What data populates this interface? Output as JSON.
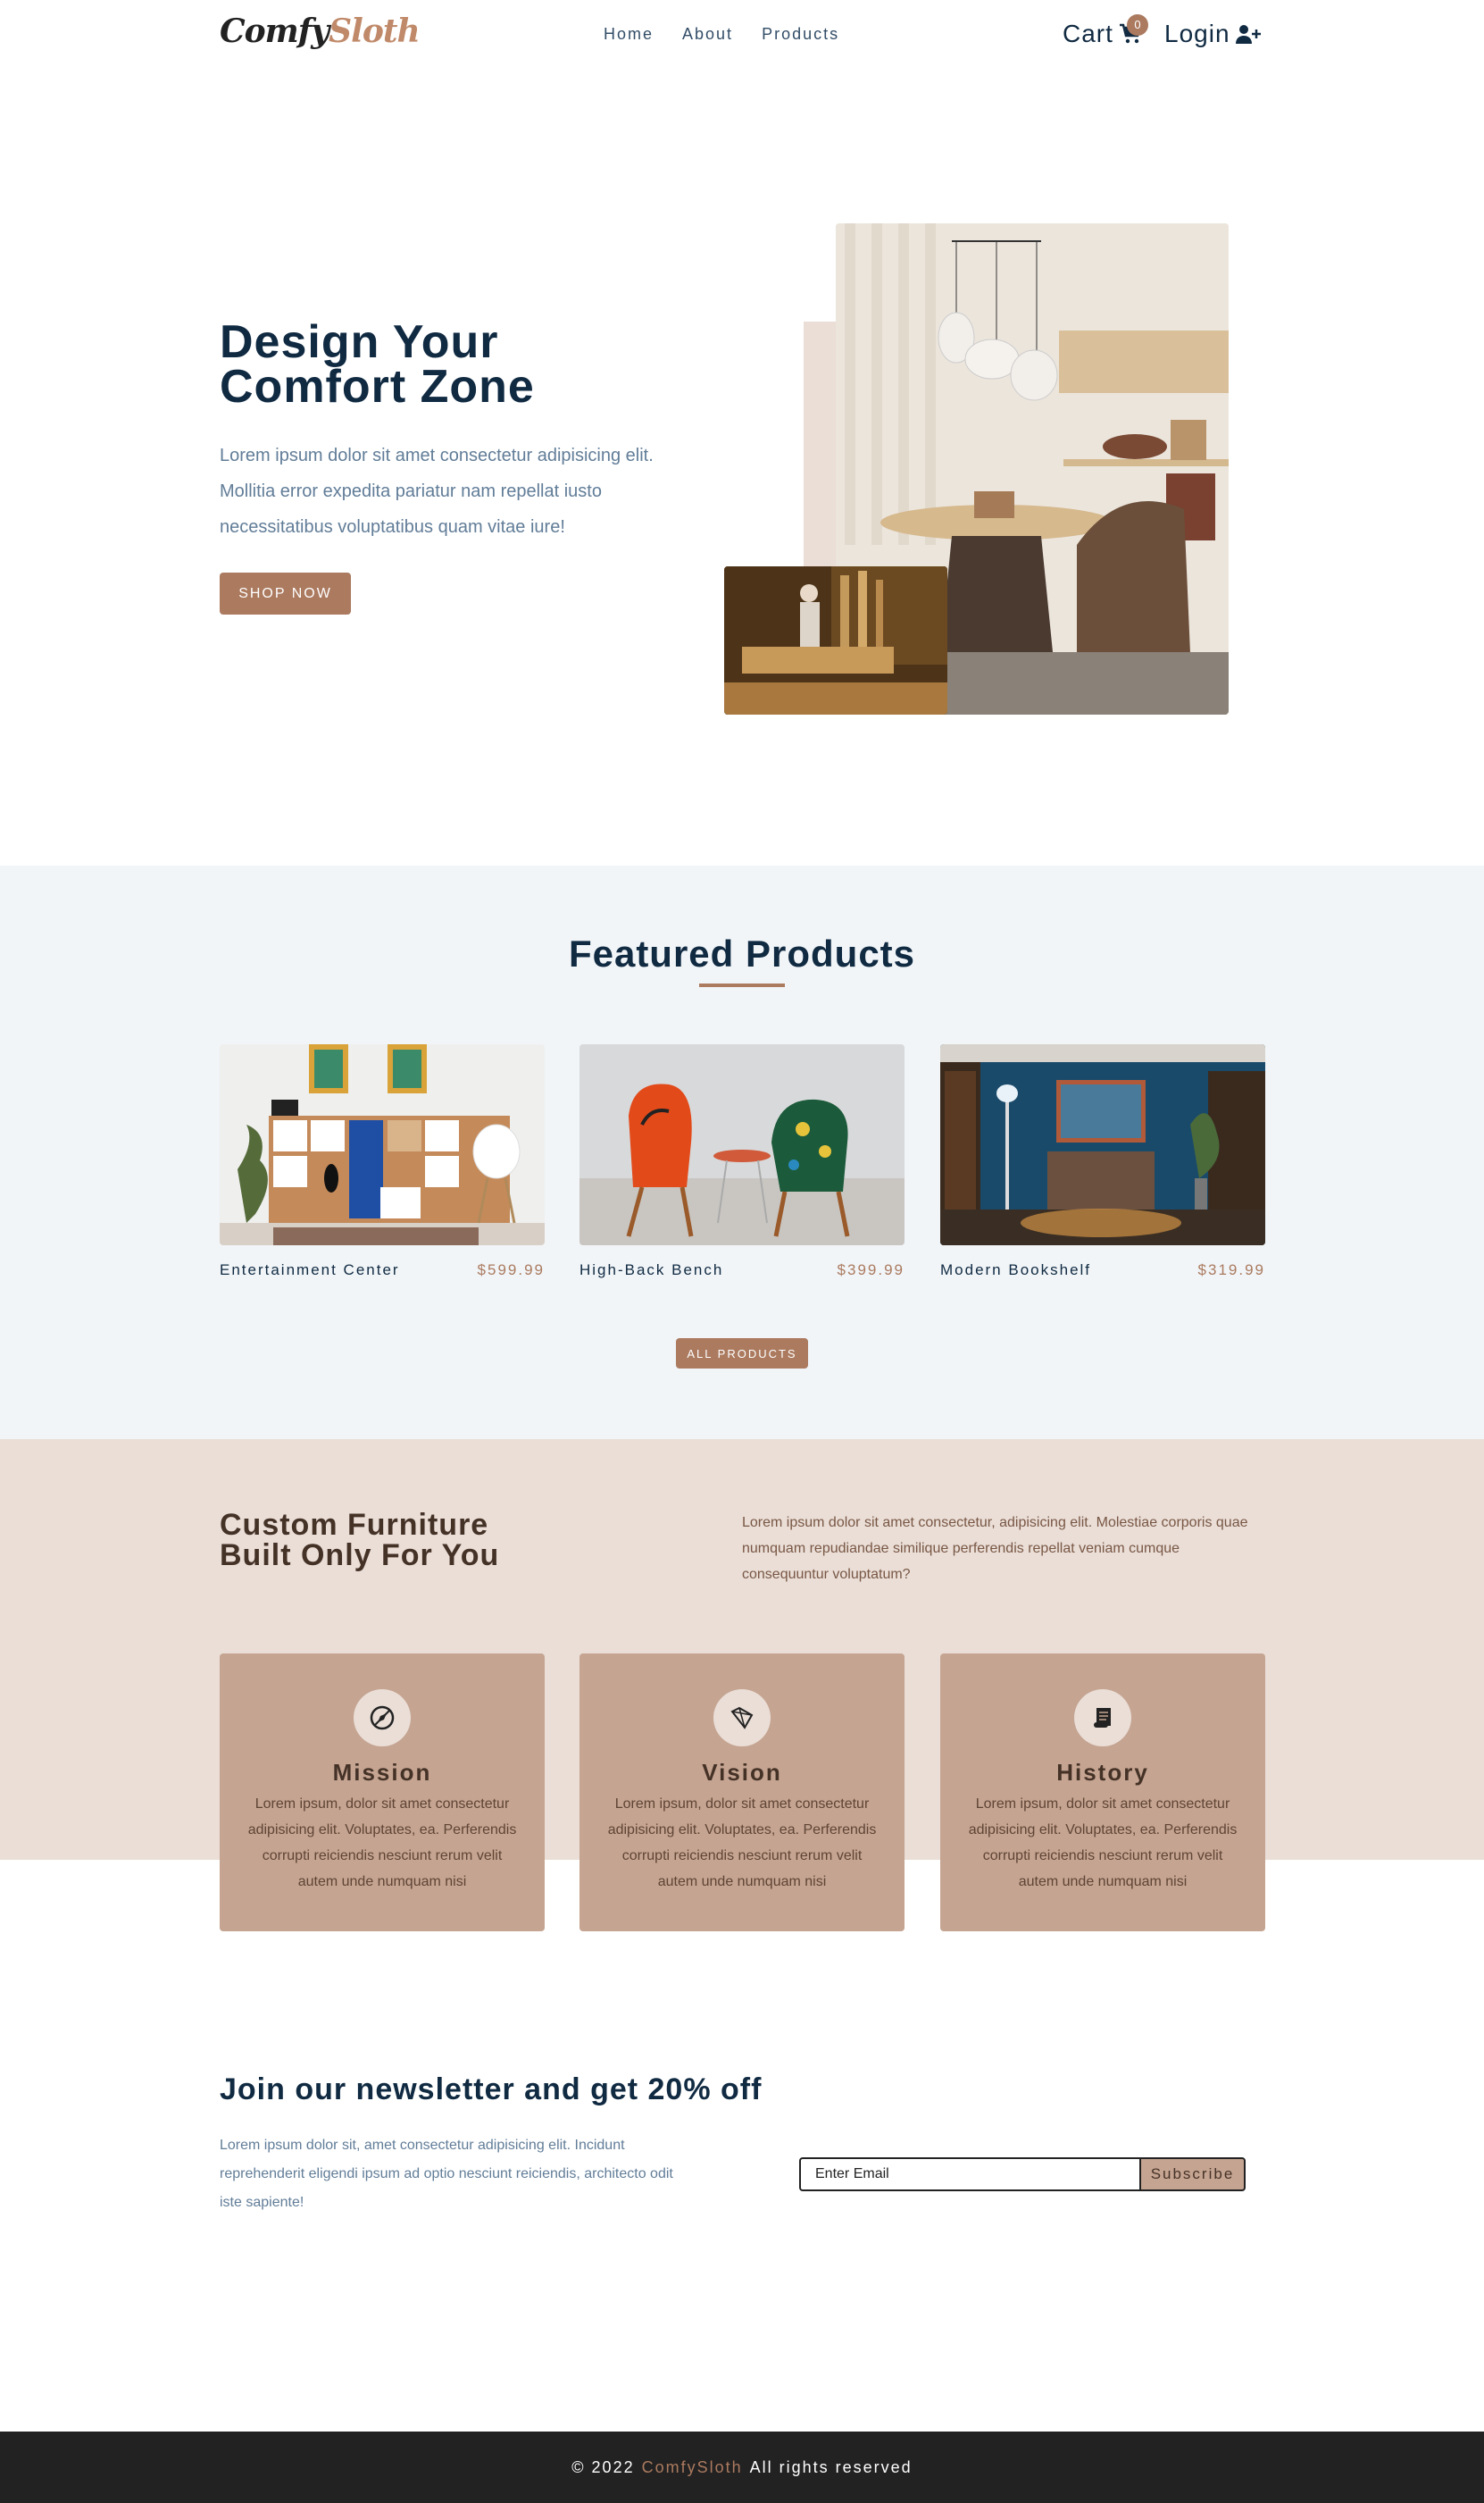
{
  "colors": {
    "primary": "#ab7a5f",
    "heading": "#102a42",
    "grey_text": "#617d98",
    "featured_bg": "#f1f5f8",
    "services_bg": "#eaded7",
    "card_bg": "#c5a491",
    "footer_bg": "#222222"
  },
  "navbar": {
    "logo_part1": "Comfy",
    "logo_part2": "Sloth",
    "links": [
      "Home",
      "About",
      "Products"
    ],
    "cart_label": "Cart",
    "cart_count": "0",
    "login_label": "Login",
    "icons": {
      "cart": "cart-icon",
      "login": "user-plus-icon"
    }
  },
  "hero": {
    "title_line1": "Design Your",
    "title_line2": "Comfort Zone",
    "text": "Lorem ipsum dolor sit amet consectetur adipisicing elit. Mollitia error expedita pariatur nam repellat iusto necessitatibus voluptatibus quam vitae iure!",
    "button": "SHOP NOW"
  },
  "featured": {
    "title": "Featured Products",
    "products": [
      {
        "name": "Entertainment Center",
        "price": "$599.99"
      },
      {
        "name": "High-Back Bench",
        "price": "$399.99"
      },
      {
        "name": "Modern Bookshelf",
        "price": "$319.99"
      }
    ],
    "all_button": "ALL PRODUCTS"
  },
  "services": {
    "title_line1": "Custom Furniture",
    "title_line2": "Built Only For You",
    "text": "Lorem ipsum dolor sit amet consectetur, adipisicing elit. Molestiae corporis quae numquam repudiandae similique perferendis repellat veniam cumque consequuntur voluptatum?",
    "cards": [
      {
        "title": "Mission",
        "text": "Lorem ipsum, dolor sit amet consectetur adipisicing elit. Voluptates, ea. Perferendis corrupti reiciendis nesciunt rerum velit autem unde numquam nisi",
        "icon": "compass-icon"
      },
      {
        "title": "Vision",
        "text": "Lorem ipsum, dolor sit amet consectetur adipisicing elit. Voluptates, ea. Perferendis corrupti reiciendis nesciunt rerum velit autem unde numquam nisi",
        "icon": "diamond-icon"
      },
      {
        "title": "History",
        "text": "Lorem ipsum, dolor sit amet consectetur adipisicing elit. Voluptates, ea. Perferendis corrupti reiciendis nesciunt rerum velit autem unde numquam nisi",
        "icon": "scroll-icon"
      }
    ]
  },
  "newsletter": {
    "title": "Join our newsletter and get 20% off",
    "text": "Lorem ipsum dolor sit, amet consectetur adipisicing elit. Incidunt reprehenderit eligendi ipsum ad optio nesciunt reiciendis, architecto odit iste sapiente!",
    "placeholder": "Enter Email",
    "button": "Subscribe"
  },
  "footer": {
    "prefix": "© 2022",
    "brand": "ComfySloth",
    "suffix": "All rights reserved"
  }
}
